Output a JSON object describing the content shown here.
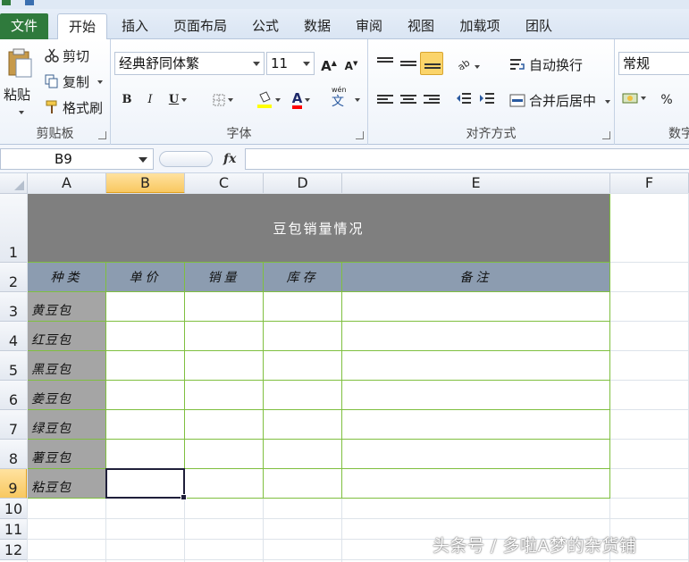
{
  "ribbon_tabs": [
    {
      "label": "文件"
    },
    {
      "label": "开始"
    },
    {
      "label": "插入"
    },
    {
      "label": "页面布局"
    },
    {
      "label": "公式"
    },
    {
      "label": "数据"
    },
    {
      "label": "审阅"
    },
    {
      "label": "视图"
    },
    {
      "label": "加载项"
    },
    {
      "label": "团队"
    }
  ],
  "clipboard": {
    "paste": "粘贴",
    "cut": "剪切",
    "copy": "复制",
    "format_painter": "格式刷",
    "group_label": "剪贴板"
  },
  "font": {
    "name": "经典舒同体繁",
    "size": "11",
    "grow": "A",
    "shrink": "A",
    "bold": "B",
    "italic": "I",
    "underline": "U",
    "font_color_letter": "A",
    "phonetic": "wén",
    "phonetic_char": "文",
    "group_label": "字体",
    "fill_color": "#ffff00",
    "font_color": "#ff0000"
  },
  "alignment": {
    "wrap_text": "自动换行",
    "merge_center": "合并后居中",
    "group_label": "对齐方式"
  },
  "number": {
    "format": "常规",
    "percent": "%",
    "group_label": "数字"
  },
  "formula_bar": {
    "name_box": "B9",
    "fx": "fx",
    "value": ""
  },
  "columns": [
    "A",
    "B",
    "C",
    "D",
    "E",
    "F"
  ],
  "rows": [
    "1",
    "2",
    "3",
    "4",
    "5",
    "6",
    "7",
    "8",
    "9",
    "10",
    "11",
    "12"
  ],
  "sheet": {
    "title": "豆包销量情况",
    "headers": [
      "种类",
      "单价",
      "销量",
      "库存",
      "备注"
    ],
    "items": [
      "黄豆包",
      "红豆包",
      "黑豆包",
      "姜豆包",
      "绿豆包",
      "薯豆包",
      "粘豆包"
    ]
  },
  "selected": {
    "column": "B",
    "row": "9"
  },
  "watermark": "头条号 / 多啦A梦的杂货铺"
}
